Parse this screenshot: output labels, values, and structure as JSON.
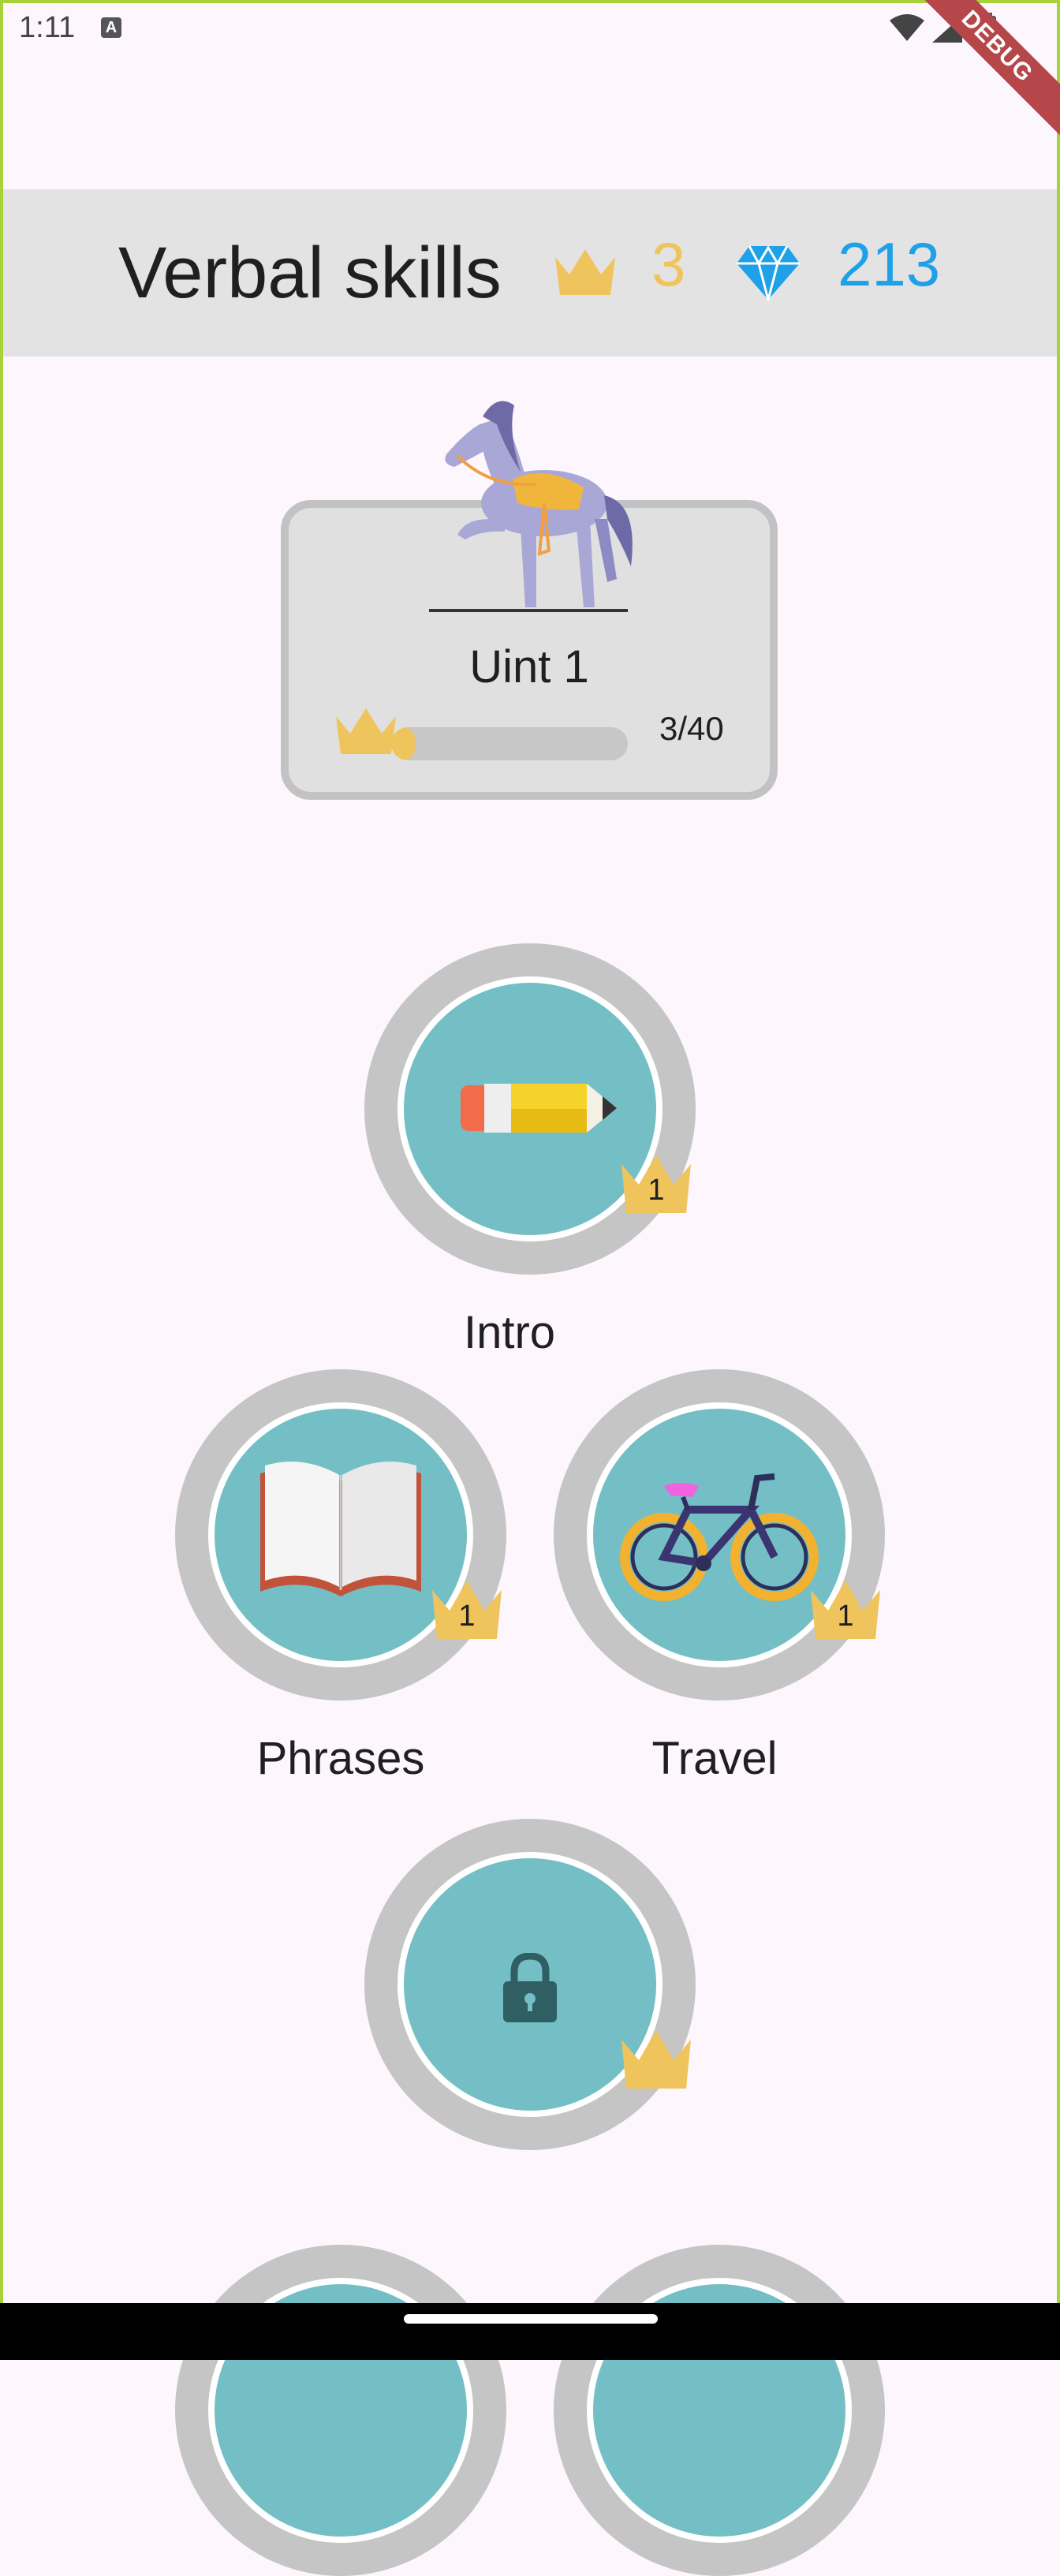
{
  "status_bar": {
    "time": "1:11",
    "a_glyph": "A",
    "debug_label": "DEBUG"
  },
  "header": {
    "title": "Verbal skills",
    "crowns": "3",
    "gems": "213",
    "crown_color": "#f0c45c",
    "gem_color": "#1ea1e8"
  },
  "unit": {
    "title": "Uint 1",
    "progress_label": "3/40",
    "progress_fraction": 0.075,
    "image_icon": "horse-icon"
  },
  "skills": [
    {
      "label": "Intro",
      "crown_level": "1",
      "icon": "pencil-icon"
    },
    {
      "label": "Phrases",
      "crown_level": "1",
      "icon": "book-icon"
    },
    {
      "label": "Travel",
      "crown_level": "1",
      "icon": "bicycle-icon"
    },
    {
      "label": "",
      "crown_level": "",
      "icon": "lock-icon",
      "locked": true
    }
  ],
  "colors": {
    "background": "#fdf6fc",
    "skill_fill": "#74bfc6",
    "ring": "#c5c5c5",
    "accent_border": "#a8d23a"
  }
}
